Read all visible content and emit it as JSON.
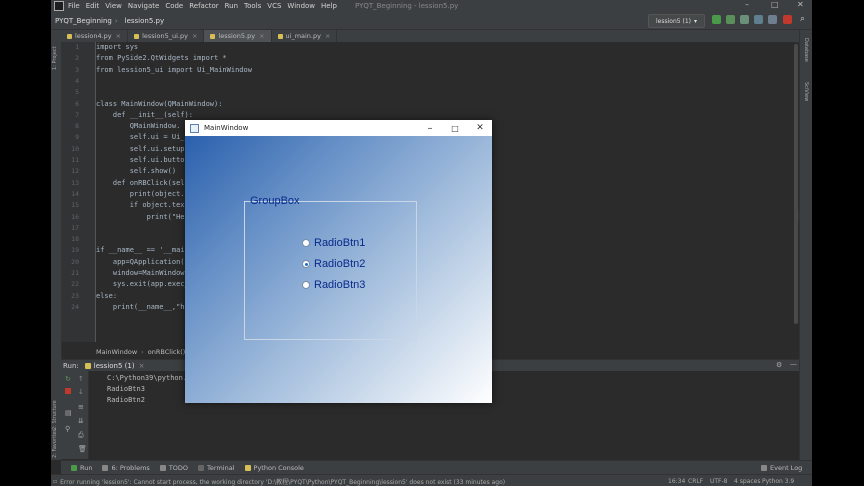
{
  "ide": {
    "menu": [
      "File",
      "Edit",
      "View",
      "Navigate",
      "Code",
      "Refactor",
      "Run",
      "Tools",
      "VCS",
      "Window",
      "Help"
    ],
    "window_title": "PYQT_Beginning - lession5.py",
    "breadcrumb": [
      "PYQT_Beginning",
      "lession5.py"
    ],
    "run_config": "lession5 (1)",
    "tabs": [
      {
        "label": "lession4.py",
        "active": false
      },
      {
        "label": "lession5_ui.py",
        "active": false
      },
      {
        "label": "lession5.py",
        "active": true
      },
      {
        "label": "ui_main.py",
        "active": false
      }
    ],
    "left_tools": [
      "1: Project",
      "2: Structure",
      "2: Favorites"
    ],
    "right_tools": [
      "Database",
      "SciView"
    ],
    "warnings": "9",
    "line_numbers": [
      "1",
      "2",
      "3",
      "4",
      "5",
      "6",
      "7",
      "8",
      "9",
      "10",
      "11",
      "12",
      "13",
      "14",
      "15",
      "16",
      "17",
      "18",
      "19",
      "20",
      "21",
      "22",
      "23",
      "24"
    ],
    "code_lines": [
      "import sys",
      "from PySide2.QtWidgets import *",
      "from lession5_ui import Ui_MainWindow",
      "",
      "",
      "class MainWindow(QMainWindow):",
      "    def __init__(self):",
      "        QMainWindow.",
      "        self.ui = Ui_",
      "        self.ui.setup",
      "        self.ui.butto",
      "        self.show()",
      "    def onRBClick(sel",
      "        print(object.",
      "        if object.tex",
      "            print(\"He",
      "",
      "",
      "if __name__ == '__mai",
      "    app=QApplication(s",
      "    window=MainWindow(",
      "    sys.exit(app.exec_",
      "else:",
      "    print(__name__,\"h"
    ],
    "code_breadcrumb": [
      "MainWindow",
      "onRBClick()"
    ],
    "run": {
      "label": "Run:",
      "config": "lession5 (1)",
      "output": [
        "C:\\Python39\\python.ex",
        "RadioBtn3",
        "RadioBtn2"
      ]
    },
    "bottom_tabs": [
      "Run",
      "6: Problems",
      "TODO",
      "Terminal",
      "Python Console"
    ],
    "event_log": "Event Log",
    "status": {
      "message": "Error running 'lession5': Cannot start process, the working directory 'D:\\教程\\PYQT\\Python\\PYQT_Beginning\\lession5' does not exist (33 minutes ago)",
      "position": "16:34",
      "line_sep": "CRLF",
      "encoding": "UTF-8",
      "indent": "4 spaces",
      "interpreter": "Python 3.9"
    }
  },
  "app_window": {
    "title": "MainWindow",
    "groupbox_title": "GroupBox",
    "radios": [
      {
        "label": "RadioBtn1",
        "checked": false
      },
      {
        "label": "RadioBtn2",
        "checked": true
      },
      {
        "label": "RadioBtn3",
        "checked": false
      }
    ]
  }
}
